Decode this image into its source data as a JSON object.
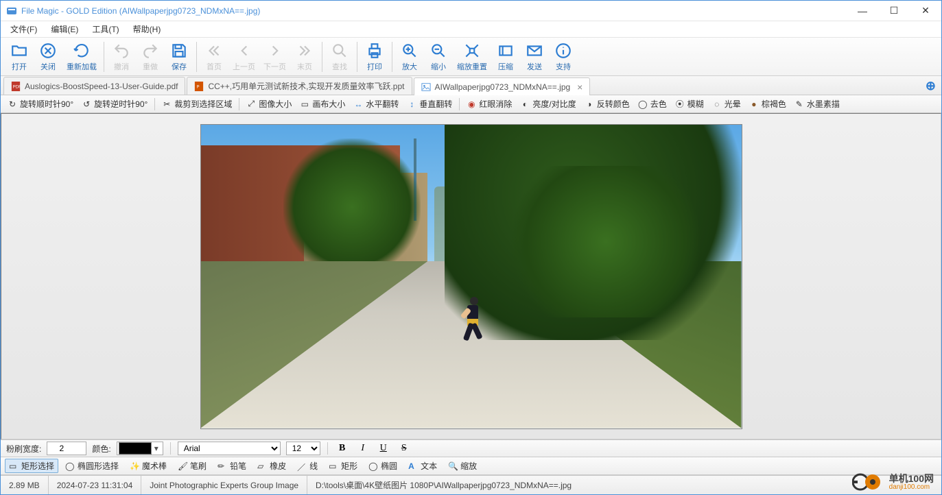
{
  "window": {
    "title": "File Magic - GOLD Edition (AIWallpaperjpg0723_NDMxNA==.jpg)"
  },
  "menus": {
    "file": "文件(F)",
    "edit": "编辑(E)",
    "tools": "工具(T)",
    "help": "帮助(H)"
  },
  "toolbar": {
    "open": "打开",
    "close": "关闭",
    "reload": "重新加载",
    "undo": "撤消",
    "redo": "重做",
    "save": "保存",
    "first": "首页",
    "prev": "上一页",
    "next": "下一页",
    "last": "末页",
    "find": "查找",
    "print": "打印",
    "zoom_in": "放大",
    "zoom_out": "缩小",
    "zoom_reset": "缩放重置",
    "compress": "压缩",
    "send": "发送",
    "support": "支持"
  },
  "tabs": [
    {
      "label": "Auslogics-BoostSpeed-13-User-Guide.pdf",
      "type": "pdf",
      "active": false
    },
    {
      "label": "CC++,巧用单元测试新技术,实现开发质量效率飞跃.ppt",
      "type": "ppt",
      "active": false
    },
    {
      "label": "AIWallpaperjpg0723_NDMxNA==.jpg",
      "type": "jpg",
      "active": true
    }
  ],
  "image_toolbar": {
    "rotate_cw": "旋转顺时针90°",
    "rotate_ccw": "旋转逆时针90°",
    "crop": "裁剪到选择区域",
    "image_size": "图像大小",
    "canvas_size": "画布大小",
    "flip_h": "水平翻转",
    "flip_v": "垂直翻转",
    "redeye": "红眼消除",
    "brightness": "亮度/对比度",
    "invert": "反转颜色",
    "desaturate": "去色",
    "blur": "模糊",
    "halo": "光晕",
    "sepia": "棕褐色",
    "ink": "水墨素描"
  },
  "brush_bar": {
    "width_label": "粉刷宽度:",
    "width_value": "2",
    "color_label": "颜色:",
    "font_name": "Arial",
    "font_size": "12",
    "bold": "B",
    "italic": "I",
    "underline": "U",
    "strike": "S"
  },
  "draw_bar": {
    "rect_select": "矩形选择",
    "ellipse_select": "椭圆形选择",
    "magic_wand": "魔术棒",
    "brush": "笔刷",
    "pencil": "铅笔",
    "eraser": "橡皮",
    "line": "线",
    "rect": "矩形",
    "ellipse": "椭圆",
    "text": "文本",
    "zoom": "缩放"
  },
  "status": {
    "size": "2.89 MB",
    "date": "2024-07-23 11:31:04",
    "format": "Joint Photographic Experts Group Image",
    "path": "D:\\tools\\桌面\\4K壁纸图片 1080P\\AIWallpaperjpg0723_NDMxNA==.jpg"
  },
  "watermark": {
    "text": "单机100网",
    "sub": "danji100.com"
  }
}
